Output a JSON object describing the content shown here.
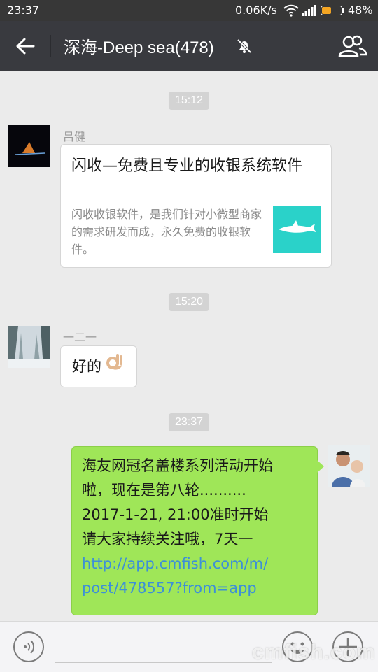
{
  "status_bar": {
    "time": "23:37",
    "network_speed": "0.06K/s",
    "battery_percent": "48%",
    "battery_level": 0.48
  },
  "header": {
    "title": "深海-Deep sea(478)",
    "back_icon": "back-arrow-icon",
    "mute_icon": "bell-muted-icon",
    "members_icon": "group-members-icon"
  },
  "messages": [
    {
      "timestamp": "15:12",
      "sender": "吕健",
      "type": "link_card",
      "card_title": "闪收—免费且专业的收银系统软件",
      "card_desc": "闪收收银软件，是我们针对小微型商家的需求研发而成，永久免费的收银软件。"
    },
    {
      "timestamp": "15:20",
      "sender": "一二一",
      "type": "text",
      "text": "好的"
    },
    {
      "timestamp": "23:37",
      "sender": "",
      "type": "text_outgoing",
      "lines": [
        "海友网冠名盖楼系列活动开始",
        "啦，现在是第八轮..........",
        "2017-1-21, 21:00准时开始",
        "请大家持续关注哦，7天一"
      ],
      "link_lines": [
        "http://app.cmfish.com/m/",
        "post/478557?from=app"
      ]
    }
  ],
  "input_bar": {
    "voice_icon": "voice-icon",
    "emoji_icon": "emoji-icon",
    "plus_icon": "plus-icon"
  },
  "watermark": "cmfish.com",
  "colors": {
    "header_bg": "#393a3f",
    "chat_bg": "#ebebeb",
    "outgoing_bubble": "#9fe658",
    "link": "#3d8fd8"
  }
}
